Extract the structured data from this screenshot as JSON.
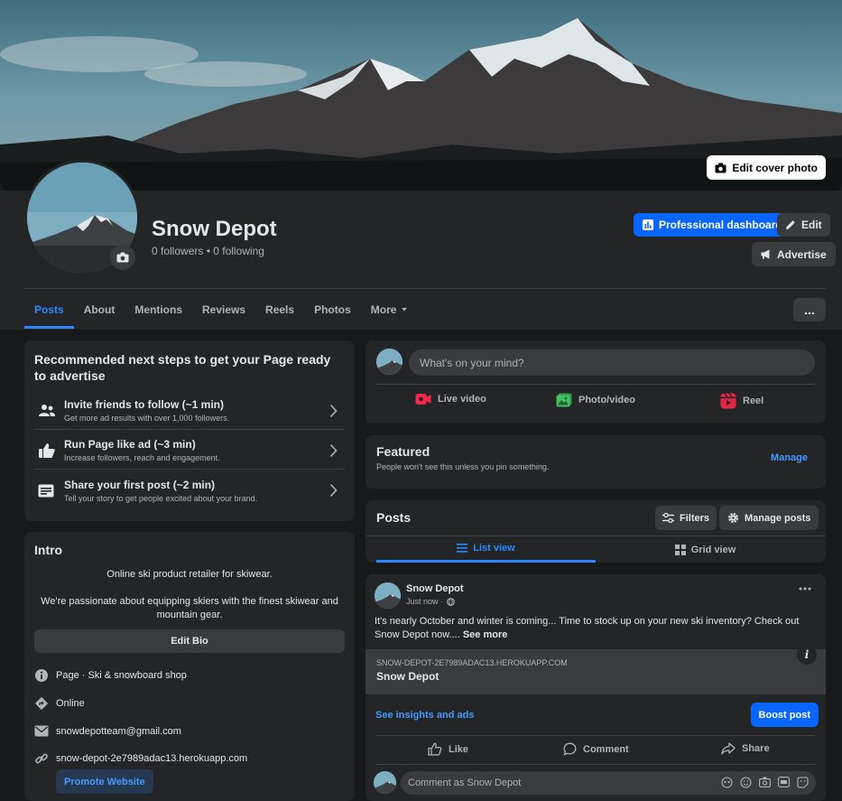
{
  "cover": {
    "edit_label": "Edit cover photo"
  },
  "profile": {
    "name": "Snow Depot",
    "stats": "0 followers • 0 following"
  },
  "header_buttons": {
    "dashboard": "Professional dashboard",
    "edit": "Edit",
    "advertise": "Advertise"
  },
  "tabs": [
    {
      "label": "Posts",
      "active": true
    },
    {
      "label": "About"
    },
    {
      "label": "Mentions"
    },
    {
      "label": "Reviews"
    },
    {
      "label": "Reels"
    },
    {
      "label": "Photos"
    },
    {
      "label": "More"
    }
  ],
  "more_menu_label": "...",
  "steps": {
    "title": "Recommended next steps to get your Page ready to advertise",
    "items": [
      {
        "title": "Invite friends to follow (~1 min)",
        "desc": "Get more ad results with over 1,000 followers.",
        "icon": "people-icon"
      },
      {
        "title": "Run Page like ad (~3 min)",
        "desc": "Increase followers, reach and engagement.",
        "icon": "thumbs-up-icon"
      },
      {
        "title": "Share your first post (~2 min)",
        "desc": "Tell your story to get people excited about your brand.",
        "icon": "post-icon"
      }
    ]
  },
  "intro": {
    "title": "Intro",
    "bio_line1": "Online ski product retailer for skiwear.",
    "bio_line2": "We're passionate about equipping skiers with the finest skiwear and mountain gear.",
    "edit_bio": "Edit Bio",
    "page_type": "Page · Ski & snowboard shop",
    "online": "Online",
    "email": "snowdepotteam@gmail.com",
    "website": "snow-depot-2e7989adac13.herokuapp.com",
    "promote": "Promote Website"
  },
  "composer": {
    "placeholder": "What's on your mind?",
    "live": "Live video",
    "photo": "Photo/video",
    "reel": "Reel"
  },
  "featured": {
    "title": "Featured",
    "subtitle": "People won't see this unless you pin something.",
    "manage": "Manage"
  },
  "posts_section": {
    "title": "Posts",
    "filters": "Filters",
    "manage_posts": "Manage posts",
    "list_view": "List view",
    "grid_view": "Grid view"
  },
  "post": {
    "author": "Snow Depot",
    "time": "Just now ·",
    "text": "It's nearly October and winter is coming... Time to stock up on your new ski inventory? Check out Snow Depot now....",
    "see_more": "See more",
    "link_url": "SNOW-DEPOT-2E7989ADAC13.HEROKUAPP.COM",
    "link_title": "Snow Depot",
    "info": "i",
    "insights": "See insights and ads",
    "boost": "Boost post",
    "like": "Like",
    "comment": "Comment",
    "share": "Share",
    "comment_placeholder": "Comment as Snow Depot"
  },
  "colors": {
    "accent": "#0866ff",
    "link": "#4599ff",
    "bg": "#18191a",
    "card": "#242526"
  }
}
